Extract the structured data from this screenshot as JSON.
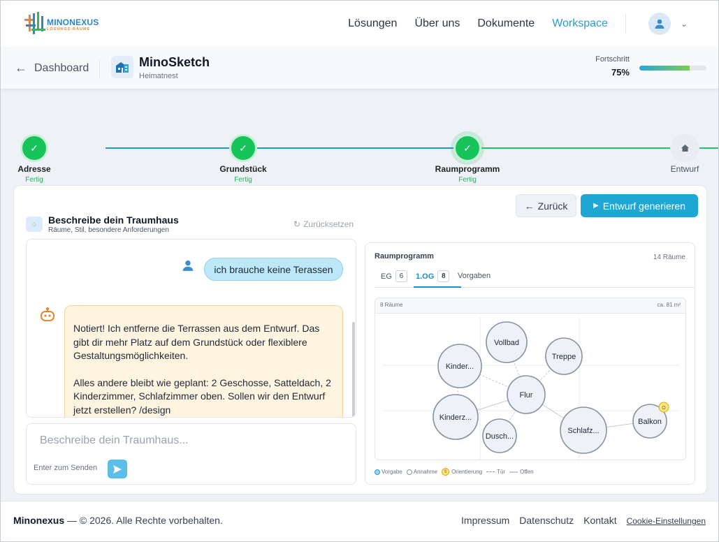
{
  "brand": {
    "name": "MINONEXUS",
    "tagline": "LÖSUNGS-RÄUME"
  },
  "nav": {
    "items": [
      "Lösungen",
      "Über uns",
      "Dokumente",
      "Workspace"
    ],
    "active": "Workspace"
  },
  "subheader": {
    "back_label": "Dashboard",
    "app_title": "MinoSketch",
    "app_subtitle": "Heimatnest",
    "progress_label": "Fortschritt",
    "progress_value": "75%",
    "progress_fraction": 0.75
  },
  "steps": [
    {
      "label": "Adresse",
      "status": "Fertig"
    },
    {
      "label": "Grundstück",
      "status": "Fertig"
    },
    {
      "label": "Raumprogramm",
      "status": "Fertig"
    },
    {
      "label": "Entwurf",
      "status": ""
    }
  ],
  "actions": {
    "back": "Zurück",
    "generate": "Entwurf generieren"
  },
  "chat": {
    "title": "Beschreibe dein Traumhaus",
    "subtitle": "Räume, Stil, besondere Anforderungen",
    "reset": "Zurücksetzen",
    "user_message": "ich brauche keine Terassen",
    "bot_p1": "Notiert! Ich entferne die Terrassen aus dem Entwurf. Das gibt dir mehr Platz auf dem Grundstück oder flexiblere Gestaltungsmöglichkeiten.",
    "bot_p2": "Alles andere bleibt wie geplant: 2 Geschosse, Satteldach, 2 Kinderzimmer, Schlafzimmer oben. Sollen wir den Entwurf jetzt erstellen? /design",
    "input_placeholder": "Beschreibe dein Traumhaus...",
    "send_hint": "Enter zum Senden"
  },
  "rooms": {
    "title": "Raumprogramm",
    "count": "14 Räume",
    "tabs": [
      {
        "label": "EG",
        "count": "6"
      },
      {
        "label": "1.OG",
        "count": "8"
      },
      {
        "label": "Vorgaben",
        "count": ""
      }
    ],
    "active_tab": "1.OG",
    "plan_rooms": "8 Räume",
    "plan_area": "ca. 81 m²",
    "nodes": [
      "Vollbad",
      "Kinder...",
      "Treppe",
      "Flur",
      "Kinderz...",
      "Schlafz...",
      "Balkon",
      "Dusch..."
    ],
    "orientation_badge": "O",
    "legend": [
      "Vorgabe",
      "Annahme",
      "Orientierung",
      "Tür",
      "Offen"
    ],
    "legend_badge": "S"
  },
  "footer": {
    "brand": "Minonexus",
    "copyright": "— © 2026. Alle Rechte vorbehalten.",
    "links": [
      "Impressum",
      "Datenschutz",
      "Kontakt",
      "Cookie-Einstellungen"
    ]
  }
}
